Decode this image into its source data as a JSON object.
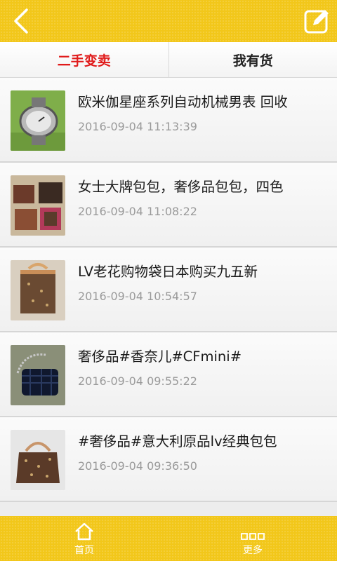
{
  "header": {
    "back_icon": "chevron-left-icon",
    "edit_icon": "edit-note-icon",
    "accent_color": "#f2c71a"
  },
  "tabs": [
    {
      "label": "二手变卖",
      "active": true
    },
    {
      "label": "我有货",
      "active": false
    }
  ],
  "items": [
    {
      "title": "欧米伽星座系列自动机械男表 回收",
      "time": "2016-09-04 11:13:39",
      "thumb": "watch-photo"
    },
    {
      "title": "女士大牌包包，奢侈品包包，四色",
      "time": "2016-09-04 11:08:22",
      "thumb": "bags-photo"
    },
    {
      "title": "LV老花购物袋日本购买九五新",
      "time": "2016-09-04 10:54:57",
      "thumb": "lv-tote-photo"
    },
    {
      "title": "奢侈品#香奈儿#CFmini#",
      "time": "2016-09-04 09:55:22",
      "thumb": "chanel-bag-photo"
    },
    {
      "title": "#奢侈品#意大利原品lv经典包包",
      "time": "2016-09-04 09:36:50",
      "thumb": "lv-bag-photo"
    }
  ],
  "bottom_nav": [
    {
      "label": "首页",
      "icon": "home-icon"
    },
    {
      "label": "更多",
      "icon": "more-icon"
    }
  ]
}
